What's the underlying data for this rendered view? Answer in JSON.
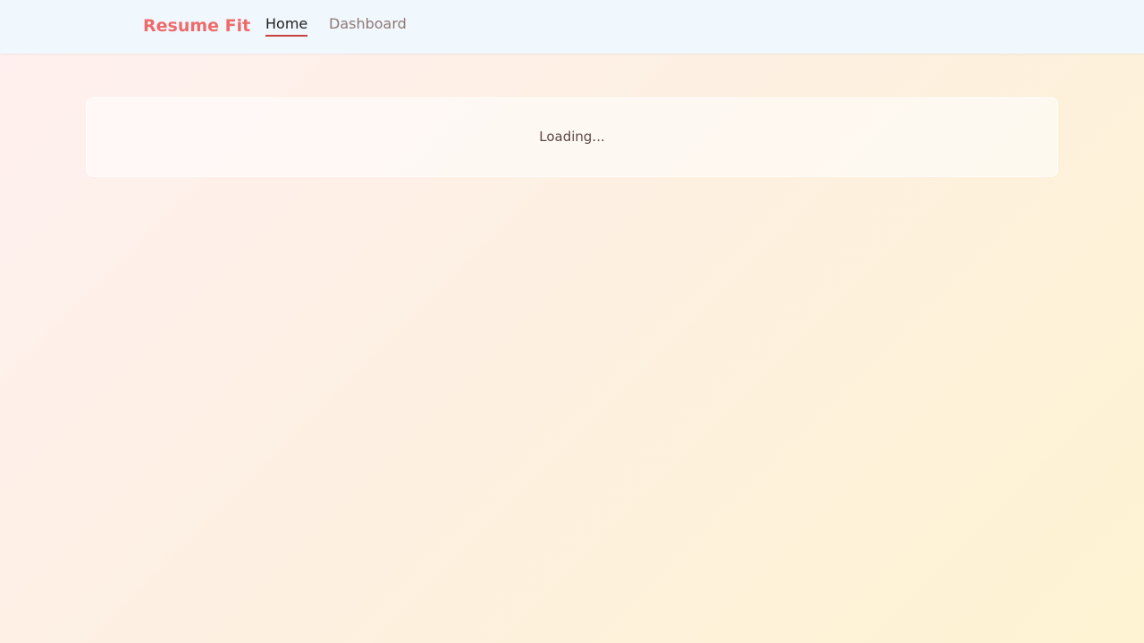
{
  "navbar": {
    "brand": "Resume Fit",
    "links": [
      {
        "label": "Home",
        "active": true
      },
      {
        "label": "Dashboard",
        "active": false
      }
    ]
  },
  "main": {
    "status_text": "Loading..."
  },
  "colors": {
    "brand": "#ee6b6b",
    "active_underline": "#c84141",
    "nav_background": "#f0f7fd"
  }
}
